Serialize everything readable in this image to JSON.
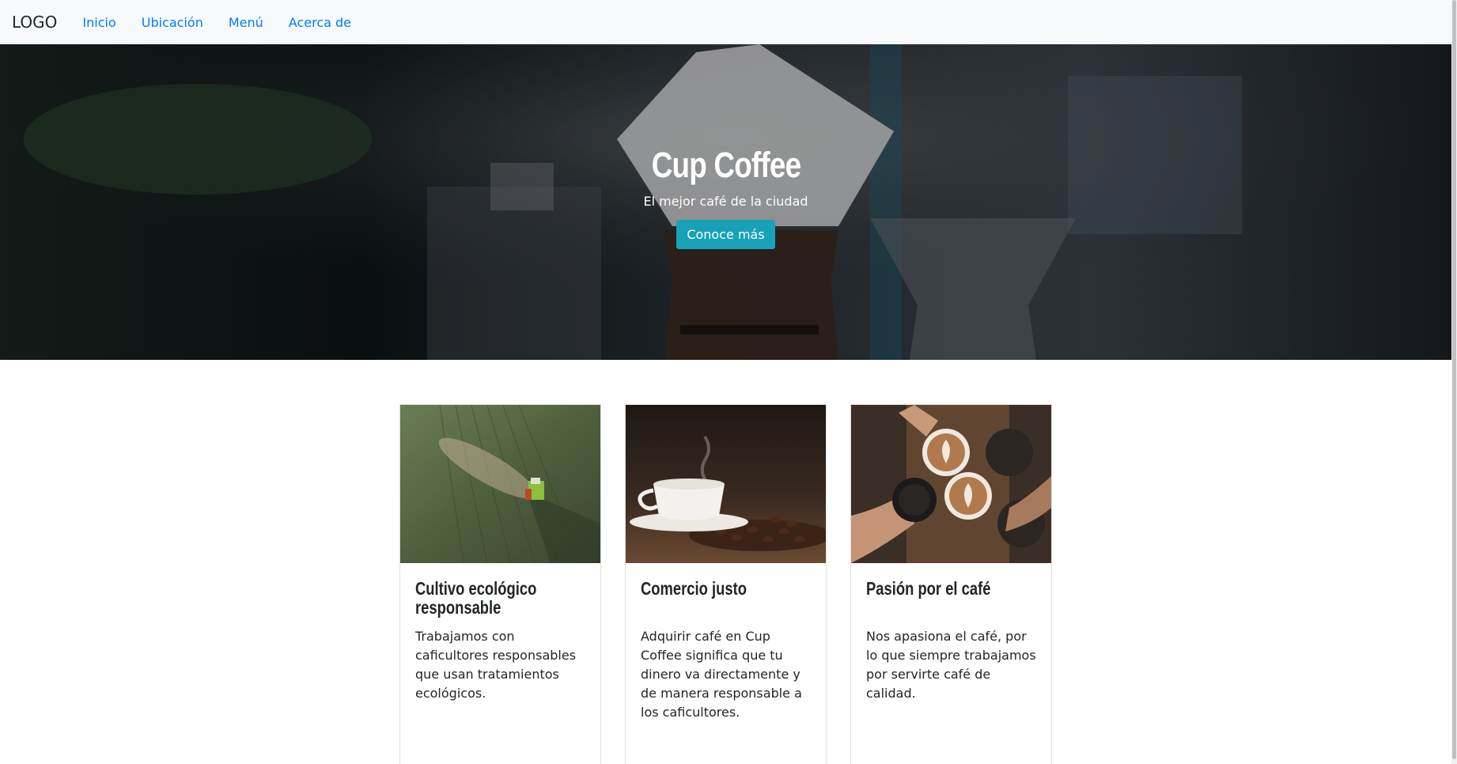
{
  "navbar": {
    "brand": "LOGO",
    "links": [
      "Inicio",
      "Ubicación",
      "Menú",
      "Acerca de"
    ]
  },
  "hero": {
    "title": "Cup Coffee",
    "subtitle": "El mejor café de la ciudad",
    "button_label": "Conoce más"
  },
  "cards": [
    {
      "title": "Cultivo ecológico responsable",
      "text": "Trabajamos con caficultores responsables que usan tratamientos ecológicos."
    },
    {
      "title": "Comercio justo",
      "text": "Adquirir café en Cup Coffee significa que tu dinero va directamente y de manera responsable a los caficultores."
    },
    {
      "title": "Pasión por el café",
      "text": "Nos apasiona el café, por lo que siempre trabajamos por servirte café de calidad."
    }
  ],
  "colors": {
    "link": "#007bff",
    "button": "#17a2b8",
    "navbar_bg": "#f8f9fa"
  }
}
